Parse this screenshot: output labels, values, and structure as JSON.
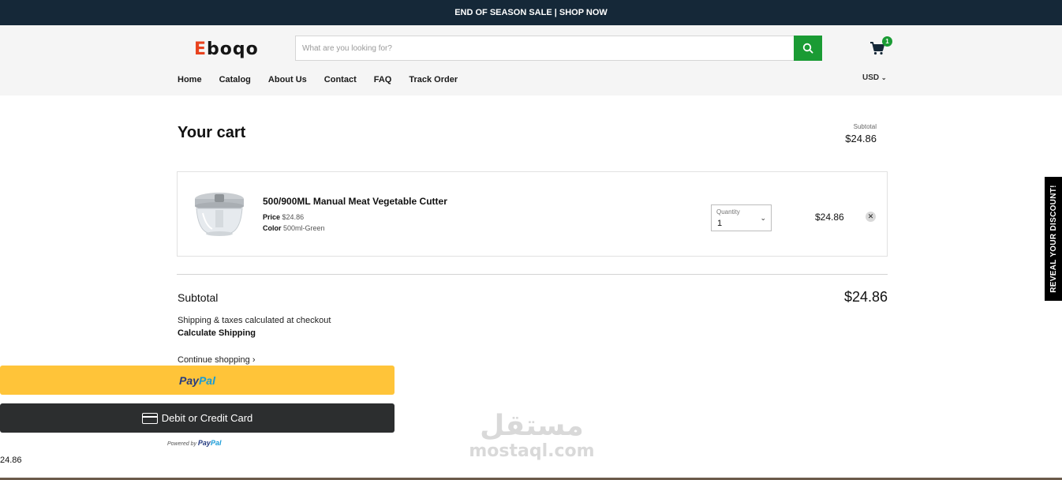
{
  "announcement": "END OF SEASON SALE | SHOP NOW",
  "header": {
    "logo_initial": "E",
    "logo_rest": "boqo",
    "search_placeholder": "What are you looking for?",
    "cart_count": "1",
    "currency": "USD"
  },
  "nav": [
    "Home",
    "Catalog",
    "About Us",
    "Contact",
    "FAQ",
    "Track Order"
  ],
  "cart": {
    "title": "Your cart",
    "subtotal_label_small": "Subtotal",
    "subtotal_value_small": "$24.86",
    "item": {
      "name": "500/900ML Manual Meat Vegetable Cutter",
      "price_label": "Price",
      "price_value": "$24.86",
      "color_label": "Color",
      "color_value": "500ml-Green",
      "quantity_label": "Quantity",
      "quantity_value": "1",
      "line_total": "$24.86"
    },
    "subtotal_label": "Subtotal",
    "subtotal_value": "$24.86",
    "shipping_note": "Shipping & taxes calculated at checkout",
    "calculate_shipping": "Calculate Shipping",
    "continue_shopping": "Continue shopping",
    "continue_arrow": "›"
  },
  "payment": {
    "paypal_part1": "Pay",
    "paypal_part2": "Pal",
    "card_label": "Debit or Credit Card",
    "powered_by": "Powered by",
    "powered_p1": "Pay",
    "powered_p2": "Pal",
    "stray_value": "24.86"
  },
  "discount_tab": "REVEAL YOUR DISCOUNT!",
  "watermark": {
    "arabic": "مستقل",
    "latin": "mostaql.com"
  },
  "colors": {
    "announce_bg": "#152838",
    "accent_green": "#1a9b34",
    "logo_orange": "#e8421e",
    "paypal_yellow": "#ffc439",
    "card_btn_dark": "#2c2e2f"
  }
}
